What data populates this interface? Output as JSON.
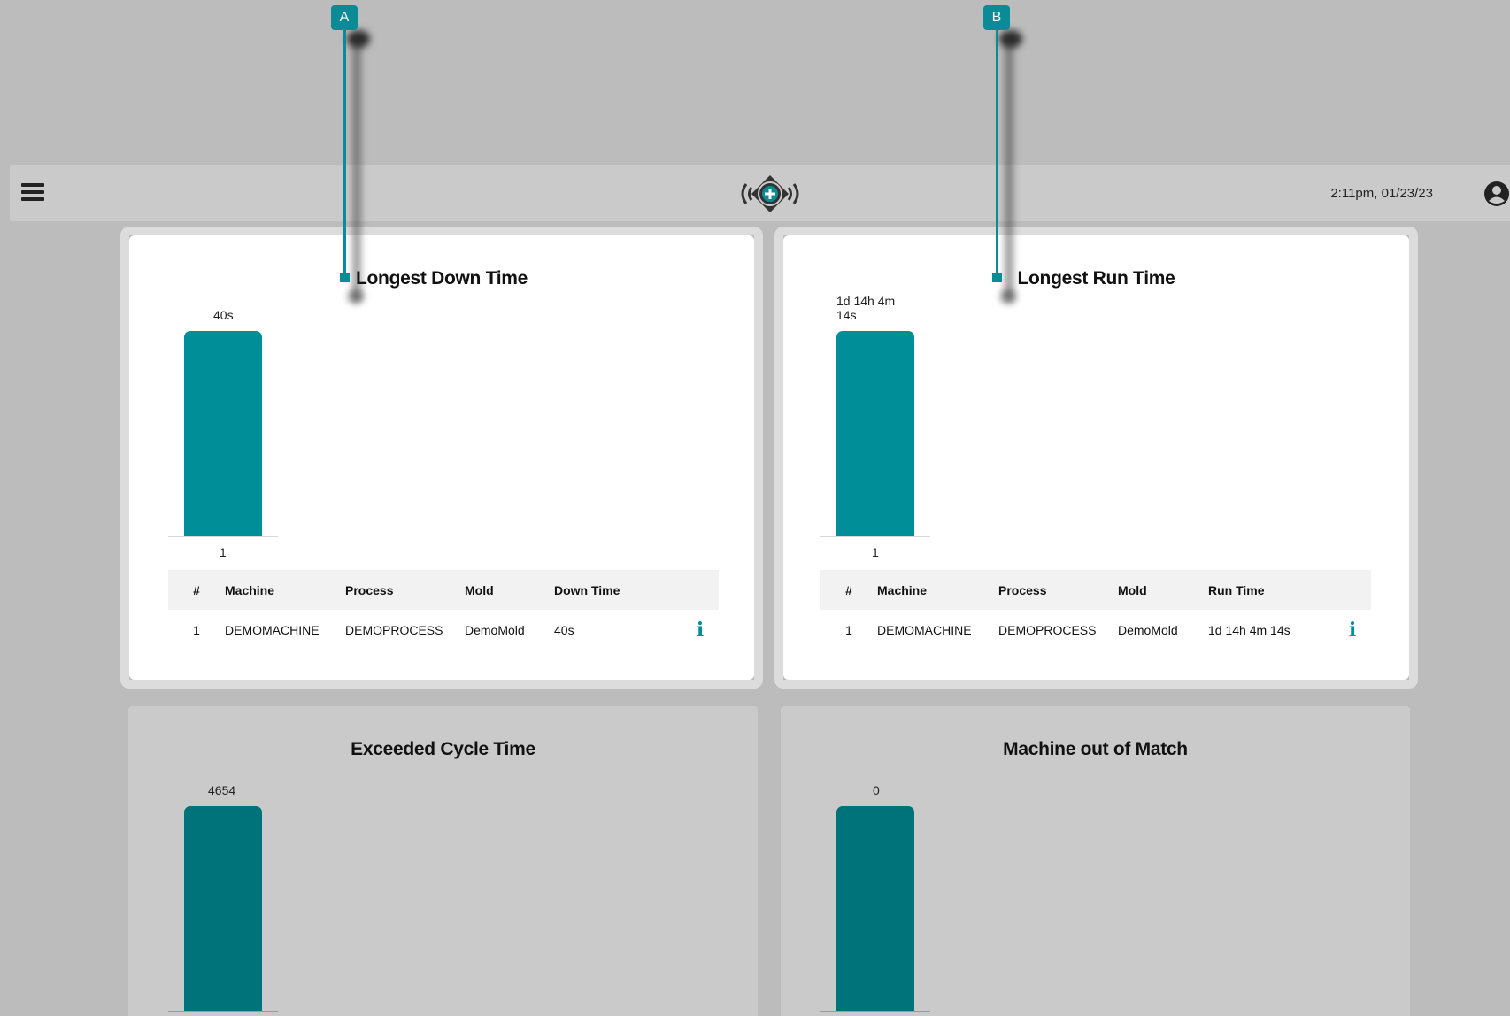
{
  "header": {
    "timestamp": "2:11pm, 01/23/23",
    "menu_icon": "hamburger-icon",
    "logo_icon": "signal-plus-logo",
    "user_icon": "user-avatar-icon"
  },
  "callouts": [
    {
      "label": "A"
    },
    {
      "label": "B"
    }
  ],
  "colors": {
    "accent": "#008f99",
    "accent_dim": "#00727a",
    "background": "#bcbcbc",
    "header": "#cacaca"
  },
  "cards": {
    "down_time": {
      "title": "Longest Down Time",
      "bar_label": "40s",
      "x_tick": "1",
      "columns": [
        "#",
        "Machine",
        "Process",
        "Mold",
        "Down Time"
      ],
      "rows": [
        {
          "num": "1",
          "machine": "DEMOMACHINE",
          "process": "DEMOPROCESS",
          "mold": "DemoMold",
          "time": "40s"
        }
      ],
      "info_icon": "i"
    },
    "run_time": {
      "title": "Longest Run Time",
      "bar_label_line1": "1d 14h 4m",
      "bar_label_line2": "14s",
      "x_tick": "1",
      "columns": [
        "#",
        "Machine",
        "Process",
        "Mold",
        "Run Time"
      ],
      "rows": [
        {
          "num": "1",
          "machine": "DEMOMACHINE",
          "process": "DEMOPROCESS",
          "mold": "DemoMold",
          "time": "1d 14h 4m 14s"
        }
      ],
      "info_icon": "i"
    },
    "cycle_time": {
      "title": "Exceeded Cycle Time",
      "bar_label": "4654"
    },
    "out_of_match": {
      "title": "Machine out of Match",
      "bar_label": "0"
    }
  },
  "chart_data": [
    {
      "type": "bar",
      "title": "Longest Down Time",
      "categories": [
        "1"
      ],
      "values": [
        40
      ],
      "value_labels": [
        "40s"
      ]
    },
    {
      "type": "bar",
      "title": "Longest Run Time",
      "categories": [
        "1"
      ],
      "values": [
        137054
      ],
      "value_labels": [
        "1d 14h 4m 14s"
      ]
    },
    {
      "type": "bar",
      "title": "Exceeded Cycle Time",
      "categories": [],
      "values": [
        4654
      ],
      "value_labels": [
        "4654"
      ]
    },
    {
      "type": "bar",
      "title": "Machine out of Match",
      "categories": [],
      "values": [
        0
      ],
      "value_labels": [
        "0"
      ]
    }
  ]
}
